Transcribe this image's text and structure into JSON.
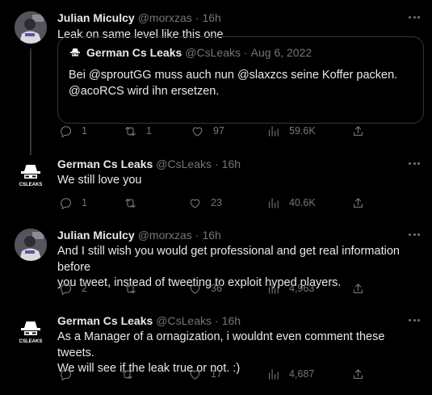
{
  "tweets": [
    {
      "name": "Julian Miculcy",
      "handle": "@morxzas",
      "time": "16h",
      "text": "Leak on same level like this one",
      "quote": {
        "name": "German Cs Leaks",
        "handle": "@CsLeaks",
        "date": "Aug 6, 2022",
        "line1": "Bei @sproutGG muss auch nun @slaxzcs seine Koffer packen.",
        "line2": "@acoRCS wird ihn ersetzen."
      },
      "replies": "1",
      "retweets": "1",
      "likes": "97",
      "views": "59.6K"
    },
    {
      "name": "German Cs Leaks",
      "handle": "@CsLeaks",
      "time": "16h",
      "text": "We still love you",
      "replies": "1",
      "retweets": "",
      "likes": "23",
      "views": "40.6K"
    },
    {
      "name": "Julian Miculcy",
      "handle": "@morxzas",
      "time": "16h",
      "line1": "And I still wish you would get professional and get real information before",
      "line2": "you tweet, instead of tweeting to exploit hyped players.",
      "replies": "2",
      "retweets": "",
      "likes": "36",
      "views": "4,963"
    },
    {
      "name": "German Cs Leaks",
      "handle": "@CsLeaks",
      "time": "16h",
      "line1": "As a Manager of a ornagization, i wouldnt even comment these tweets.",
      "line2": "We will see if the leak true or not. :)",
      "replies": "",
      "retweets": "",
      "likes": "17",
      "views": "4,687"
    }
  ],
  "brand_logo_text": "CSLEAKS",
  "separator": "·",
  "colors": {
    "background": "#000000",
    "text": "#e7e9ea",
    "muted": "#71767b",
    "border": "#333639"
  }
}
